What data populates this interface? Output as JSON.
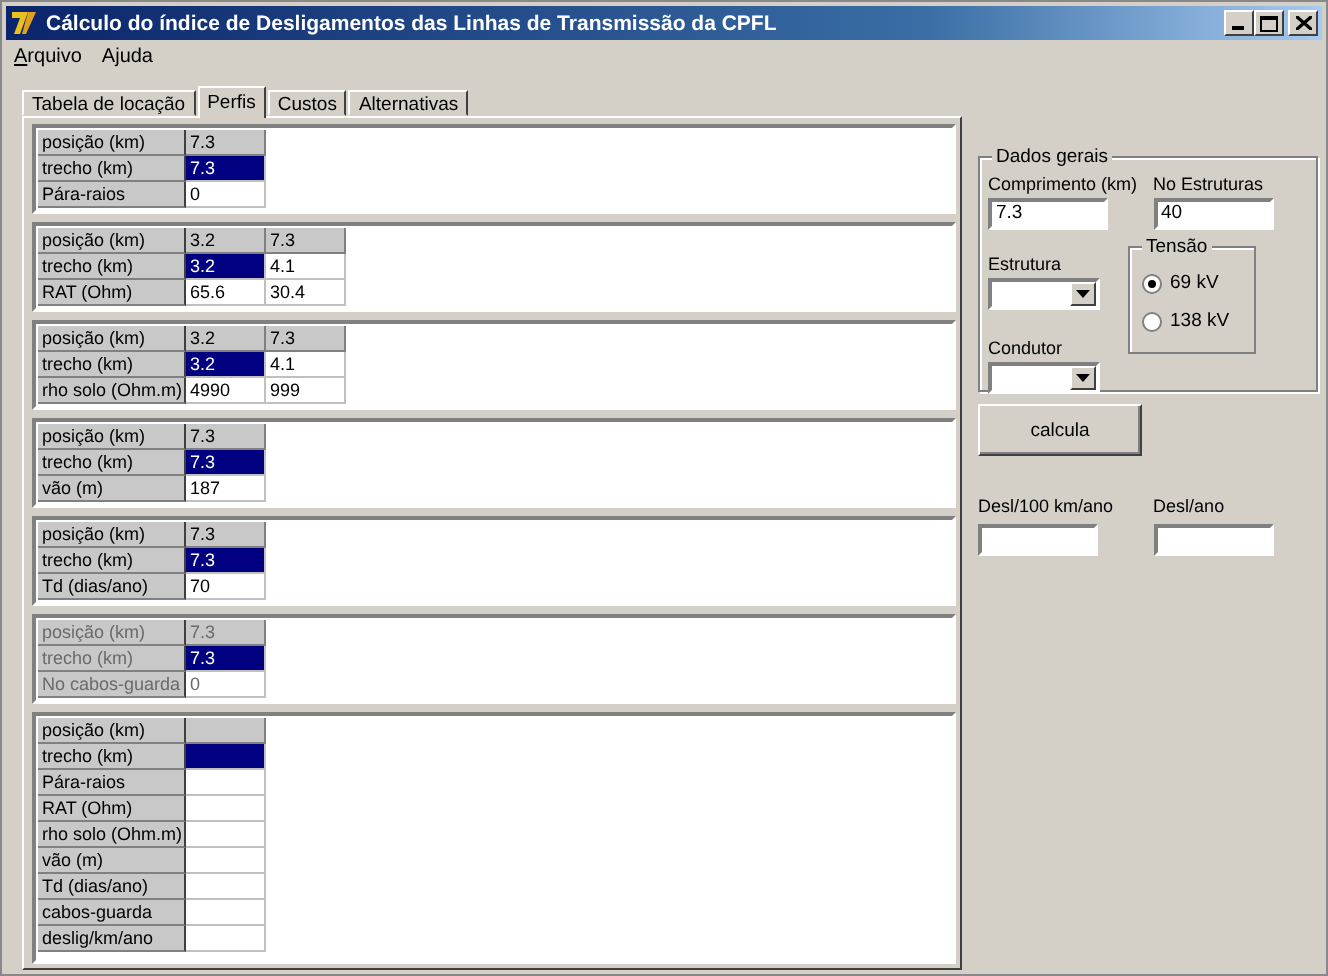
{
  "window": {
    "title": "Cálculo do índice de Desligamentos das Linhas de Transmissão da CPFL"
  },
  "menu": [
    {
      "label": "Arquivo",
      "mnemonic": true
    },
    {
      "label": "Ajuda",
      "mnemonic": false
    }
  ],
  "tabs": [
    {
      "label": "Tabela de locação",
      "selected": false
    },
    {
      "label": "Perfis",
      "selected": true
    },
    {
      "label": "Custos",
      "selected": false
    },
    {
      "label": "Alternativas",
      "selected": false
    }
  ],
  "grids": [
    {
      "disabled": false,
      "rows": [
        {
          "kind": "header",
          "label": "posição (km)",
          "cells": [
            {
              "value": "7.3",
              "selected": false
            }
          ]
        },
        {
          "kind": "data",
          "label": "trecho (km)",
          "cells": [
            {
              "value": "7.3",
              "selected": true
            }
          ]
        },
        {
          "kind": "data",
          "label": "Pára-raios",
          "cells": [
            {
              "value": "0",
              "selected": false
            }
          ]
        }
      ]
    },
    {
      "disabled": false,
      "rows": [
        {
          "kind": "header",
          "label": "posição (km)",
          "cells": [
            {
              "value": "3.2",
              "selected": false
            },
            {
              "value": "7.3",
              "selected": false
            }
          ]
        },
        {
          "kind": "data",
          "label": "trecho (km)",
          "cells": [
            {
              "value": "3.2",
              "selected": true
            },
            {
              "value": "4.1",
              "selected": false
            }
          ]
        },
        {
          "kind": "data",
          "label": "RAT (Ohm)",
          "cells": [
            {
              "value": "65.6",
              "selected": false
            },
            {
              "value": "30.4",
              "selected": false
            }
          ]
        }
      ]
    },
    {
      "disabled": false,
      "rows": [
        {
          "kind": "header",
          "label": "posição (km)",
          "cells": [
            {
              "value": "3.2",
              "selected": false
            },
            {
              "value": "7.3",
              "selected": false
            }
          ]
        },
        {
          "kind": "data",
          "label": "trecho (km)",
          "cells": [
            {
              "value": "3.2",
              "selected": true
            },
            {
              "value": "4.1",
              "selected": false
            }
          ]
        },
        {
          "kind": "data",
          "label": "rho solo (Ohm.m)",
          "cells": [
            {
              "value": "4990",
              "selected": false
            },
            {
              "value": "999",
              "selected": false
            }
          ]
        }
      ]
    },
    {
      "disabled": false,
      "rows": [
        {
          "kind": "header",
          "label": "posição (km)",
          "cells": [
            {
              "value": "7.3",
              "selected": false
            }
          ]
        },
        {
          "kind": "data",
          "label": "trecho (km)",
          "cells": [
            {
              "value": "7.3",
              "selected": true
            }
          ]
        },
        {
          "kind": "data",
          "label": "vão (m)",
          "cells": [
            {
              "value": "187",
              "selected": false
            }
          ]
        }
      ]
    },
    {
      "disabled": false,
      "rows": [
        {
          "kind": "header",
          "label": "posição (km)",
          "cells": [
            {
              "value": "7.3",
              "selected": false
            }
          ]
        },
        {
          "kind": "data",
          "label": "trecho (km)",
          "cells": [
            {
              "value": "7.3",
              "selected": true
            }
          ]
        },
        {
          "kind": "data",
          "label": "Td (dias/ano)",
          "cells": [
            {
              "value": "70",
              "selected": false
            }
          ]
        }
      ]
    },
    {
      "disabled": true,
      "rows": [
        {
          "kind": "header",
          "label": "posição (km)",
          "cells": [
            {
              "value": "7.3",
              "selected": false
            }
          ]
        },
        {
          "kind": "data",
          "label": "trecho (km)",
          "cells": [
            {
              "value": "7.3",
              "selected": true
            }
          ]
        },
        {
          "kind": "data",
          "label": "No cabos-guarda",
          "cells": [
            {
              "value": "0",
              "selected": false
            }
          ]
        }
      ]
    },
    {
      "disabled": false,
      "rows": [
        {
          "kind": "header",
          "label": "posição (km)",
          "cells": [
            {
              "selected": false
            }
          ]
        },
        {
          "kind": "data",
          "label": "trecho (km)",
          "cells": [
            {
              "selected": true
            }
          ]
        },
        {
          "kind": "data",
          "label": "Pára-raios",
          "cells": [
            {
              "selected": false
            }
          ]
        },
        {
          "kind": "data",
          "label": "RAT (Ohm)",
          "cells": [
            {
              "selected": false
            }
          ]
        },
        {
          "kind": "data",
          "label": "rho solo (Ohm.m)",
          "cells": [
            {
              "selected": false
            }
          ]
        },
        {
          "kind": "data",
          "label": "vão (m)",
          "cells": [
            {
              "selected": false
            }
          ]
        },
        {
          "kind": "data",
          "label": "Td (dias/ano)",
          "cells": [
            {
              "selected": false
            }
          ]
        },
        {
          "kind": "data",
          "label": "cabos-guarda",
          "cells": [
            {
              "selected": false
            }
          ]
        },
        {
          "kind": "data",
          "label": "deslig/km/ano",
          "cells": [
            {
              "selected": false
            }
          ]
        }
      ]
    }
  ],
  "general": {
    "title": "Dados gerais",
    "length": {
      "label": "Comprimento (km)",
      "value": "7.3"
    },
    "structures_count": {
      "label": "No Estruturas",
      "value": "40"
    },
    "structure": {
      "label": "Estrutura"
    },
    "conductor": {
      "label": "Condutor"
    },
    "voltage": {
      "title": "Tensão",
      "options": [
        {
          "label": "69 kV",
          "selected": true
        },
        {
          "label": "138 kV",
          "selected": false
        }
      ]
    }
  },
  "calculate_button": "calcula",
  "results": [
    {
      "label": "Desl/100 km/ano"
    },
    {
      "label": "Desl/ano"
    }
  ]
}
